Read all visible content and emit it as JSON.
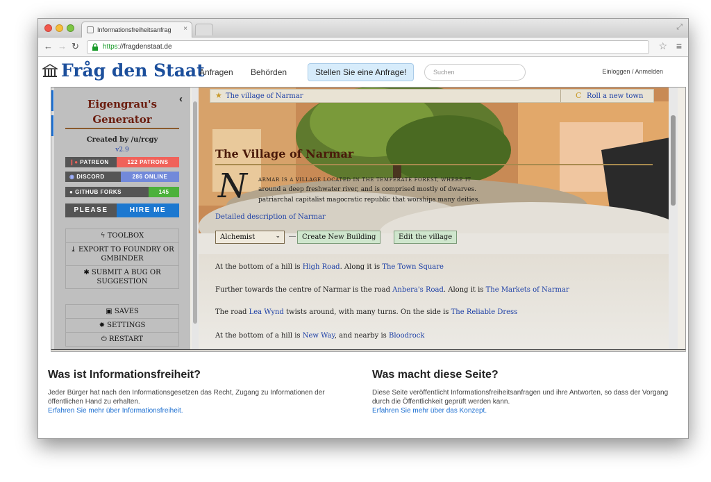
{
  "browser": {
    "tab_title": "Informationsfreiheitsanfrag",
    "url_scheme": "https",
    "url_rest": "://fragdenstaat.de"
  },
  "site": {
    "logo_text": "Fråg den Staat",
    "nav": [
      "Anfragen",
      "Behörden"
    ],
    "cta_label": "Stellen Sie eine Anfrage!",
    "search_placeholder": "Suchen",
    "login_label": "Einloggen / Anmelden"
  },
  "generator": {
    "title_line1": "Eigengrau's",
    "title_line2": "Generator",
    "created_by": "Created by /u/rcgy",
    "version": "v2.9",
    "badges": [
      {
        "left": "PATREON",
        "right": "122 PATRONS",
        "color": "#f0625a"
      },
      {
        "left": "DISCORD",
        "right": "286 ONLINE",
        "color": "#7289da"
      },
      {
        "left": "GITHUB FORKS",
        "right": "145",
        "color": "#4cb13b"
      }
    ],
    "hire_left": "PLEASE",
    "hire_right": "HIRE ME",
    "menu_a": {
      "toolbox": "TOOLBOX",
      "export": "EXPORT TO FOUNDRY OR GMBINDER",
      "bug": "SUBMIT A BUG OR SUGGESTION"
    },
    "menu_b": {
      "saves": "SAVES",
      "settings": "SETTINGS",
      "restart": "RESTART"
    }
  },
  "village": {
    "bar_name": "The village of Narmar",
    "roll_label": "Roll a new town",
    "heading": "The Village of Narmar",
    "dropcap": "N",
    "intro_caps": "ARMAR IS A VILLAGE LOCATED IN THE TEMPERATE FOREST, WHERE IT",
    "intro_line2": "around a deep freshwater river, and is comprised mostly of dwarves.",
    "intro_line3": "patriarchal capitalist magocratic republic that worships many deities.",
    "detail_link": "Detailed description of Narmar",
    "selected_building": "Alchemist",
    "create_button": "Create New Building",
    "edit_button": "Edit the village",
    "roads": [
      {
        "pre": "At the bottom of a hill is ",
        "link1": "High Road",
        "mid": ". Along it is ",
        "link2": "The Town Square"
      },
      {
        "pre": "Further towards the centre of Narmar is the road ",
        "link1": "Anbera's Road",
        "mid": ". Along it is ",
        "link2": "The Markets of Narmar"
      },
      {
        "pre": "The road ",
        "link1": "Lea Wynd",
        "mid": " twists around, with many turns. On the side is ",
        "link2": "The Reliable Dress"
      },
      {
        "pre": "At the bottom of a hill is ",
        "link1": "New Way",
        "mid": ", and nearby is ",
        "link2": "Bloodrock"
      }
    ]
  },
  "info": {
    "left_heading": "Was ist Informationsfreiheit?",
    "left_text": "Jeder Bürger hat nach den Informationsgesetzen das Recht, Zugang zu Informationen der öffentlichen Hand zu erhalten.",
    "left_link": "Erfahren Sie mehr über Informationsfreiheit.",
    "right_heading": "Was macht diese Seite?",
    "right_text": "Diese Seite veröffentlicht Informationsfreiheitsanfragen und ihre Antworten, so dass der Vorgang durch die Öffentlichkeit geprüft werden kann.",
    "right_link": "Erfahren Sie mehr über das Konzept."
  }
}
